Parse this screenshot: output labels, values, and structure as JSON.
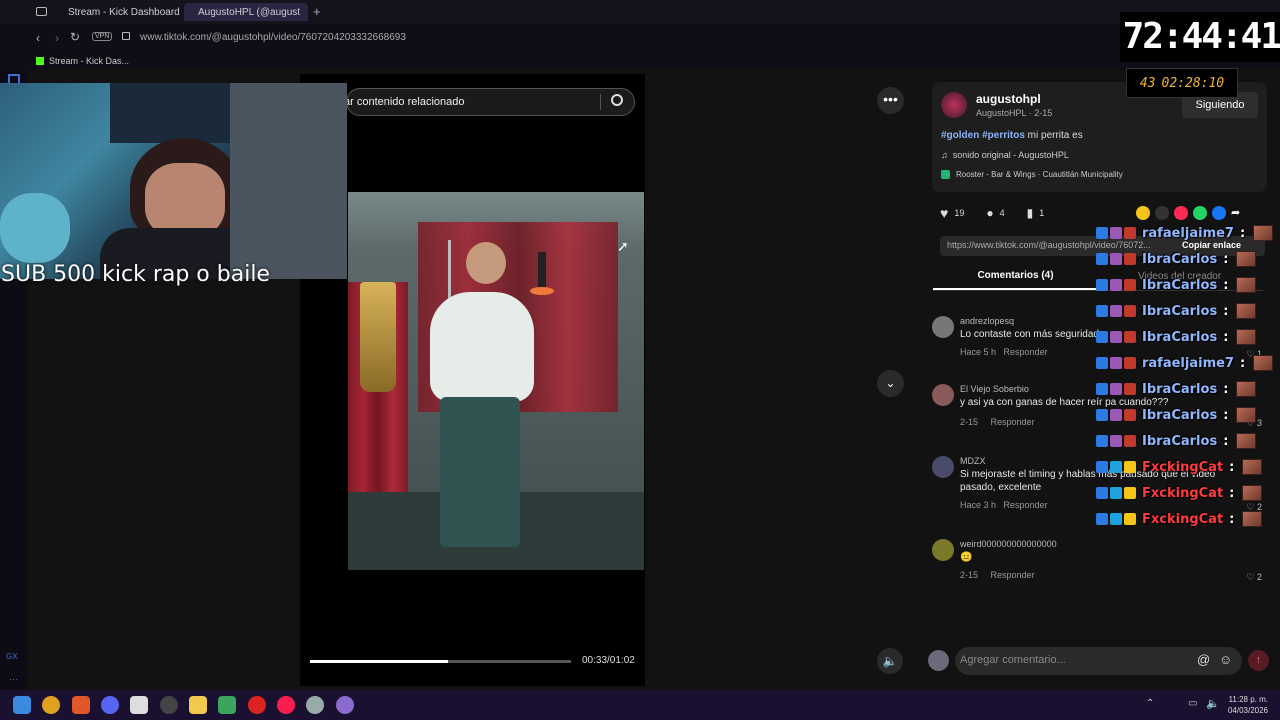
{
  "browser": {
    "tabs": [
      {
        "label": "Stream - Kick Dashboard"
      },
      {
        "label": "AugustoHPL (@august"
      }
    ],
    "vpn_label": "VPN",
    "url": "www.tiktok.com/@augustohpl/video/7607204203332668693",
    "bookmark": "Stream - Kick Das..."
  },
  "video": {
    "search_placeholder": "ar contenido relacionado",
    "time": "00:33/01:02",
    "progress_percent": 53
  },
  "stream_overlay": {
    "text": "SUB 500 kick  rap o  baile",
    "timer": "72:44:41",
    "subtimer_count": "43",
    "subtimer_clock": "02:28:10"
  },
  "post": {
    "username": "augustohpl",
    "handle_date": "AugustoHPL · 2-15",
    "follow_label": "Siguiendo",
    "caption_tags": "#golden #perritos",
    "caption_text": " mi perrita es",
    "sound": "sonido original - AugustoHPL",
    "location": "Rooster - Bar & Wings · Cuautitlán Municipality",
    "likes": "19",
    "comments": "4",
    "saves": "1",
    "link": "https://www.tiktok.com/@augustohpl/video/76072...",
    "copy_label": "Copiar enlace",
    "tab_comments": "Comentarios (4)",
    "tab_creator": "Videos del creador"
  },
  "comments": [
    {
      "user": "andrezlopesq",
      "text": "Lo contaste con más seguridad",
      "time": "Hace 5 h",
      "reply": "Responder",
      "likes": "1"
    },
    {
      "user": "El Viejo Soberbio",
      "text": "y asi ya con ganas de hacer reír pa cuando???",
      "time": "2-15",
      "reply": "Responder",
      "likes": "3"
    },
    {
      "user": "MDZX",
      "text": "Si mejoraste el timing y hablas más pausado que el video pasado, excelente",
      "time": "Hace 3 h",
      "reply": "Responder",
      "likes": "2"
    },
    {
      "user": "weird000000000000000",
      "text": "😐",
      "time": "2-15",
      "reply": "Responder",
      "likes": "2"
    }
  ],
  "comment_input_placeholder": "Agregar comentario...",
  "chat": [
    {
      "name": "rafaeljaime7",
      "color": "#8fb8ff"
    },
    {
      "name": "IbraCarlos",
      "color": "#8fb8ff"
    },
    {
      "name": "IbraCarlos",
      "color": "#8fb8ff"
    },
    {
      "name": "IbraCarlos",
      "color": "#8fb8ff"
    },
    {
      "name": "IbraCarlos",
      "color": "#8fb8ff"
    },
    {
      "name": "rafaeljaime7",
      "color": "#8fb8ff"
    },
    {
      "name": "IbraCarlos",
      "color": "#8fb8ff"
    },
    {
      "name": "IbraCarlos",
      "color": "#8fb8ff"
    },
    {
      "name": "IbraCarlos",
      "color": "#8fb8ff"
    },
    {
      "name": "FxckingCat",
      "color": "#ff3b3b"
    },
    {
      "name": "FxckingCat",
      "color": "#ff3b3b"
    },
    {
      "name": "FxckingCat",
      "color": "#ff3b3b"
    }
  ],
  "chat_separator": ":",
  "taskbar": {
    "time": "11:28 p. m.",
    "date": "04/03/2026"
  },
  "icons": [
    "search-icon",
    "more-icon",
    "heart-icon",
    "comment-icon",
    "bookmark-icon",
    "share-icon",
    "volume-icon",
    "chevron-down-icon",
    "windows-icon"
  ]
}
